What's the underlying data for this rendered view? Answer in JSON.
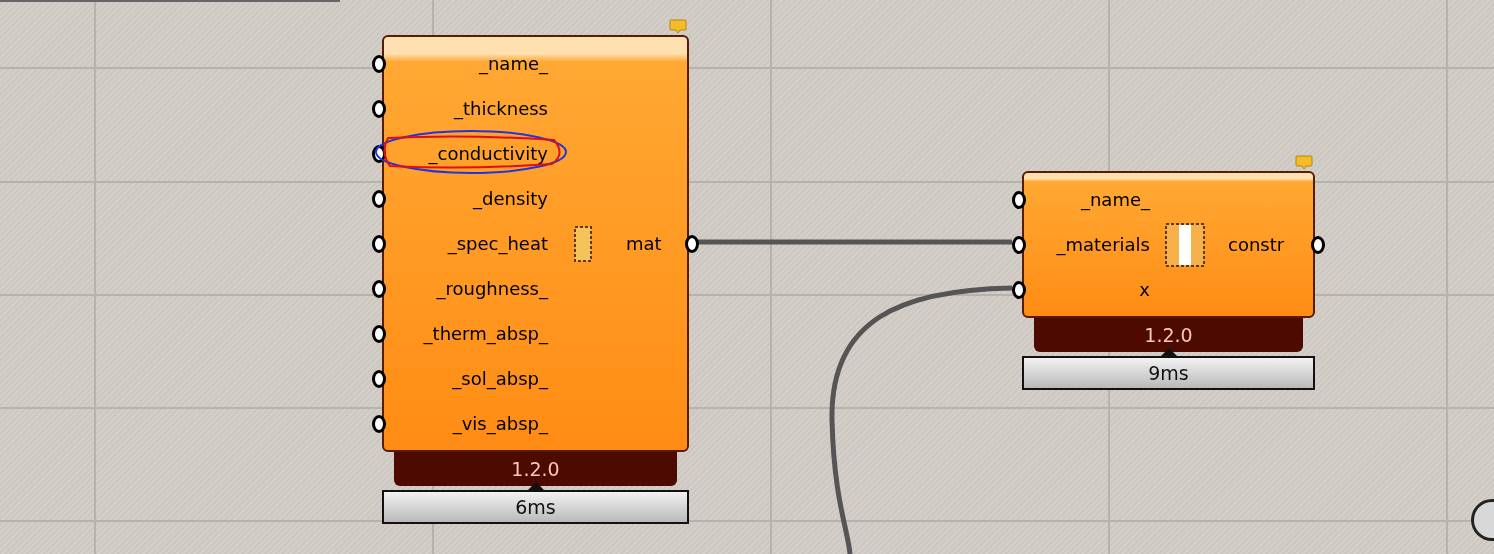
{
  "components": [
    {
      "inputs": [
        {
          "label": "_name_",
          "annotated": false
        },
        {
          "label": "_thickness",
          "annotated": false
        },
        {
          "label": "_conductivity",
          "annotated": true
        },
        {
          "label": "_density",
          "annotated": false
        },
        {
          "label": "_spec_heat",
          "annotated": false
        },
        {
          "label": "_roughness_",
          "annotated": false
        },
        {
          "label": "_therm_absp_",
          "annotated": false
        },
        {
          "label": "_sol_absp_",
          "annotated": false
        },
        {
          "label": "_vis_absp_",
          "annotated": false
        }
      ],
      "kind": "material",
      "outputs": [
        "mat"
      ],
      "version": "1.2.0",
      "timing": "6ms"
    },
    {
      "inputs": [
        {
          "label": "_name_",
          "annotated": false
        },
        {
          "label": "_materials",
          "annotated": false
        },
        {
          "label": "x",
          "annotated": false
        }
      ],
      "kind": "construction",
      "outputs": [
        "constr"
      ],
      "version": "1.2.0",
      "timing": "9ms"
    }
  ]
}
